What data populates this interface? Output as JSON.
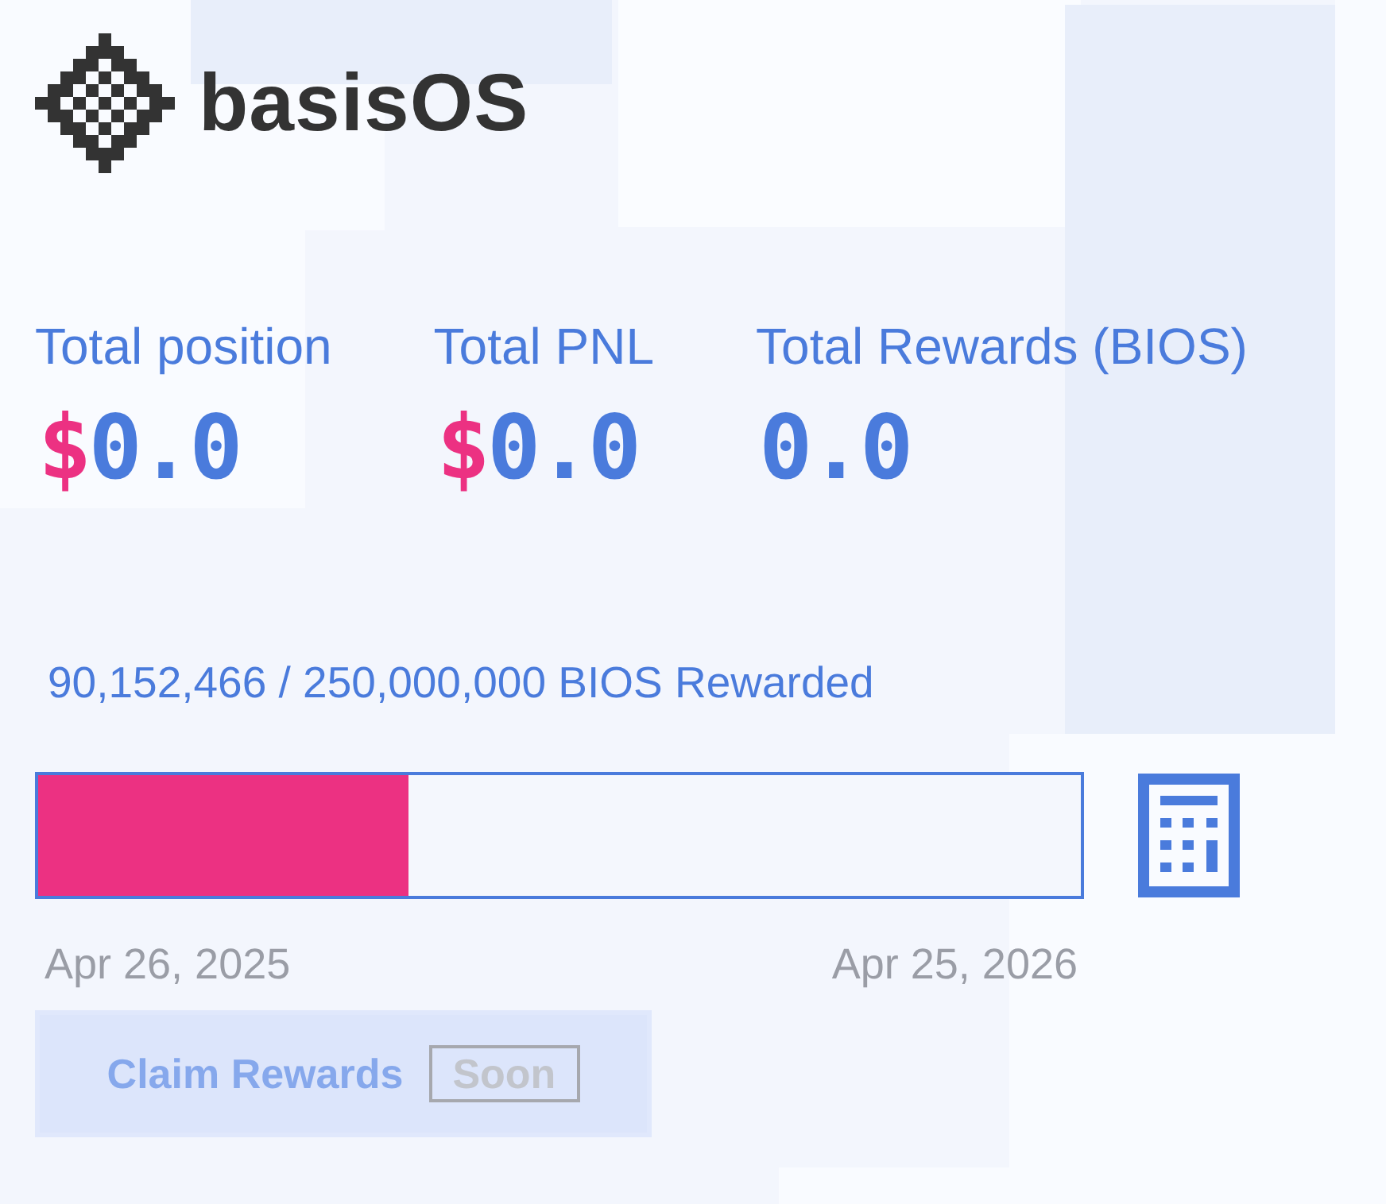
{
  "header": {
    "logo_text": "basisOS"
  },
  "stats": [
    {
      "label": "Total position",
      "currency": "$",
      "value": "0.0"
    },
    {
      "label": "Total PNL",
      "currency": "$",
      "value": "0.0"
    },
    {
      "label": "Total Rewards (BIOS)",
      "value": "0.0"
    }
  ],
  "rewards": {
    "progress_text": "90,152,466 / 250,000,000 BIOS Rewarded",
    "level": 0.355,
    "start_date": "Apr 26, 2025",
    "end_date": "Apr 25, 2026"
  },
  "claim_button": {
    "label": "Claim Rewards",
    "disabled": true,
    "badge": "Soon"
  }
}
